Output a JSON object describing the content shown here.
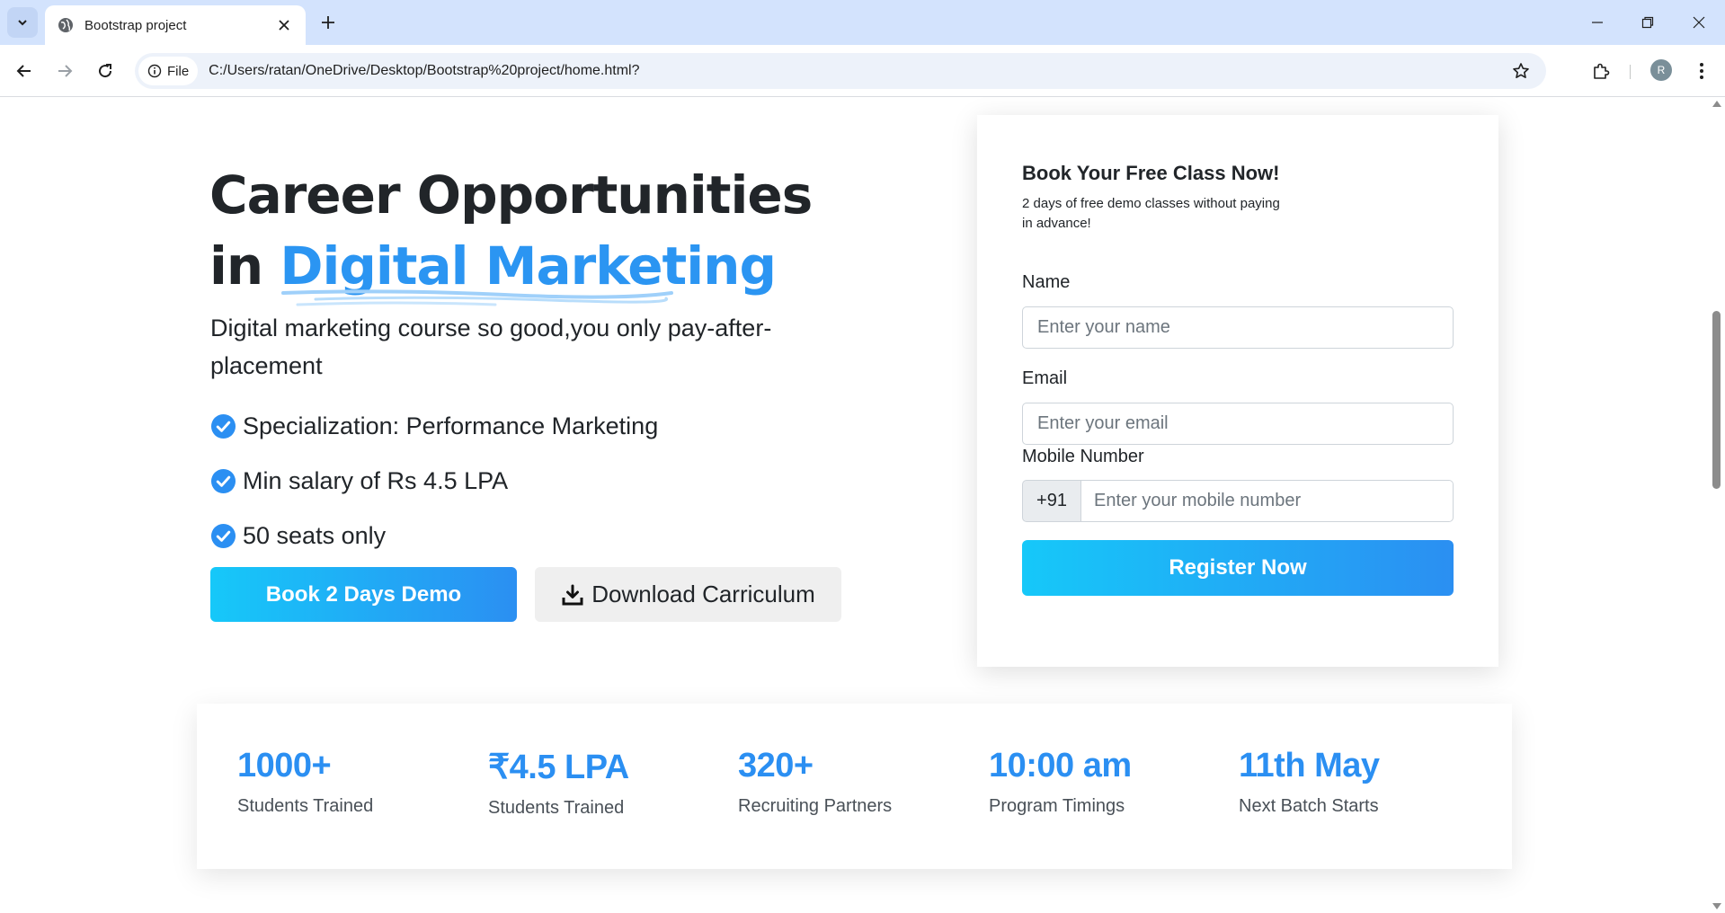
{
  "browser": {
    "tab_title": "Bootstrap project",
    "url_chip": "File",
    "url": "C:/Users/ratan/OneDrive/Desktop/Bootstrap%20project/home.html?",
    "avatar_initial": "R"
  },
  "hero": {
    "title_line1": "Career Opportunities",
    "title_in": "in",
    "title_accent": "Digital Marketing",
    "subtitle": "Digital marketing course so good,you only pay-after-placement",
    "features": [
      "Specialization: Performance Marketing",
      "Min salary of Rs 4.5 LPA",
      "50 seats only"
    ],
    "demo_button": "Book 2 Days Demo",
    "download_button": "Download Carriculum"
  },
  "form": {
    "title": "Book Your Free Class Now!",
    "description": "2 days of free demo classes without paying in advance!",
    "name_label": "Name",
    "name_placeholder": "Enter your name",
    "email_label": "Email",
    "email_placeholder": "Enter your email",
    "mobile_label": "Mobile Number",
    "mobile_prefix": "+91",
    "mobile_placeholder": "Enter your mobile number",
    "submit_label": "Register Now"
  },
  "stats": [
    {
      "value": "1000+",
      "label": "Students Trained"
    },
    {
      "value": "₹4.5 LPA",
      "label": "Students Trained"
    },
    {
      "value": "320+",
      "label": "Recruiting Partners"
    },
    {
      "value": "10:00 am",
      "label": "Program Timings"
    },
    {
      "value": "11th May",
      "label": "Next Batch Starts"
    }
  ],
  "colors": {
    "accent": "#2b95f2",
    "gradient_start": "#16c8f9",
    "gradient_end": "#2b8ff2",
    "tabbar_bg": "#d3e3fd"
  }
}
